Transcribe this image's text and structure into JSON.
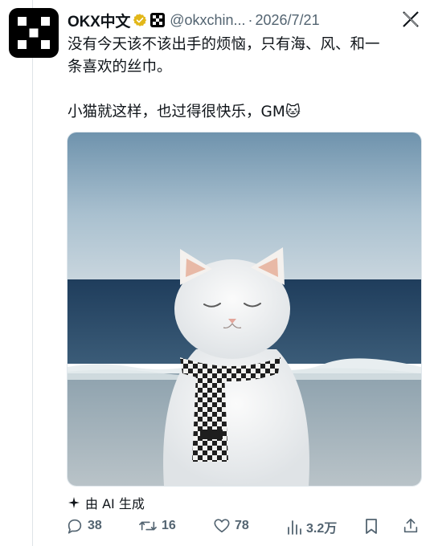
{
  "tweet": {
    "author_name": "OKX中文",
    "handle": "@okxchin...",
    "separator": "·",
    "date": "2026/7/21",
    "text_line_1": "没有今天该不该出手的烦恼，只有海、风、和一",
    "text_line_2": "条喜欢的丝巾。",
    "text_line_3": "小猫就这样，也过得很快乐，GM🐱",
    "ai_label": "由 AI 生成"
  },
  "actions": {
    "replies": "38",
    "retweets": "16",
    "likes": "78",
    "views": "3.2万"
  },
  "icons": {
    "avatar": "okx-logo",
    "verified": "gold-check-badge",
    "affiliate": "okx-affiliate-badge",
    "platform": "x-logo",
    "ai": "sparkle-icon",
    "reply": "reply-icon",
    "retweet": "retweet-icon",
    "like": "heart-icon",
    "views": "views-icon",
    "bookmark": "bookmark-icon",
    "share": "share-icon"
  },
  "colors": {
    "text": "#0f1419",
    "secondary": "#536471",
    "verified_gold": "#e2b719",
    "avatar_bg": "#000000"
  }
}
